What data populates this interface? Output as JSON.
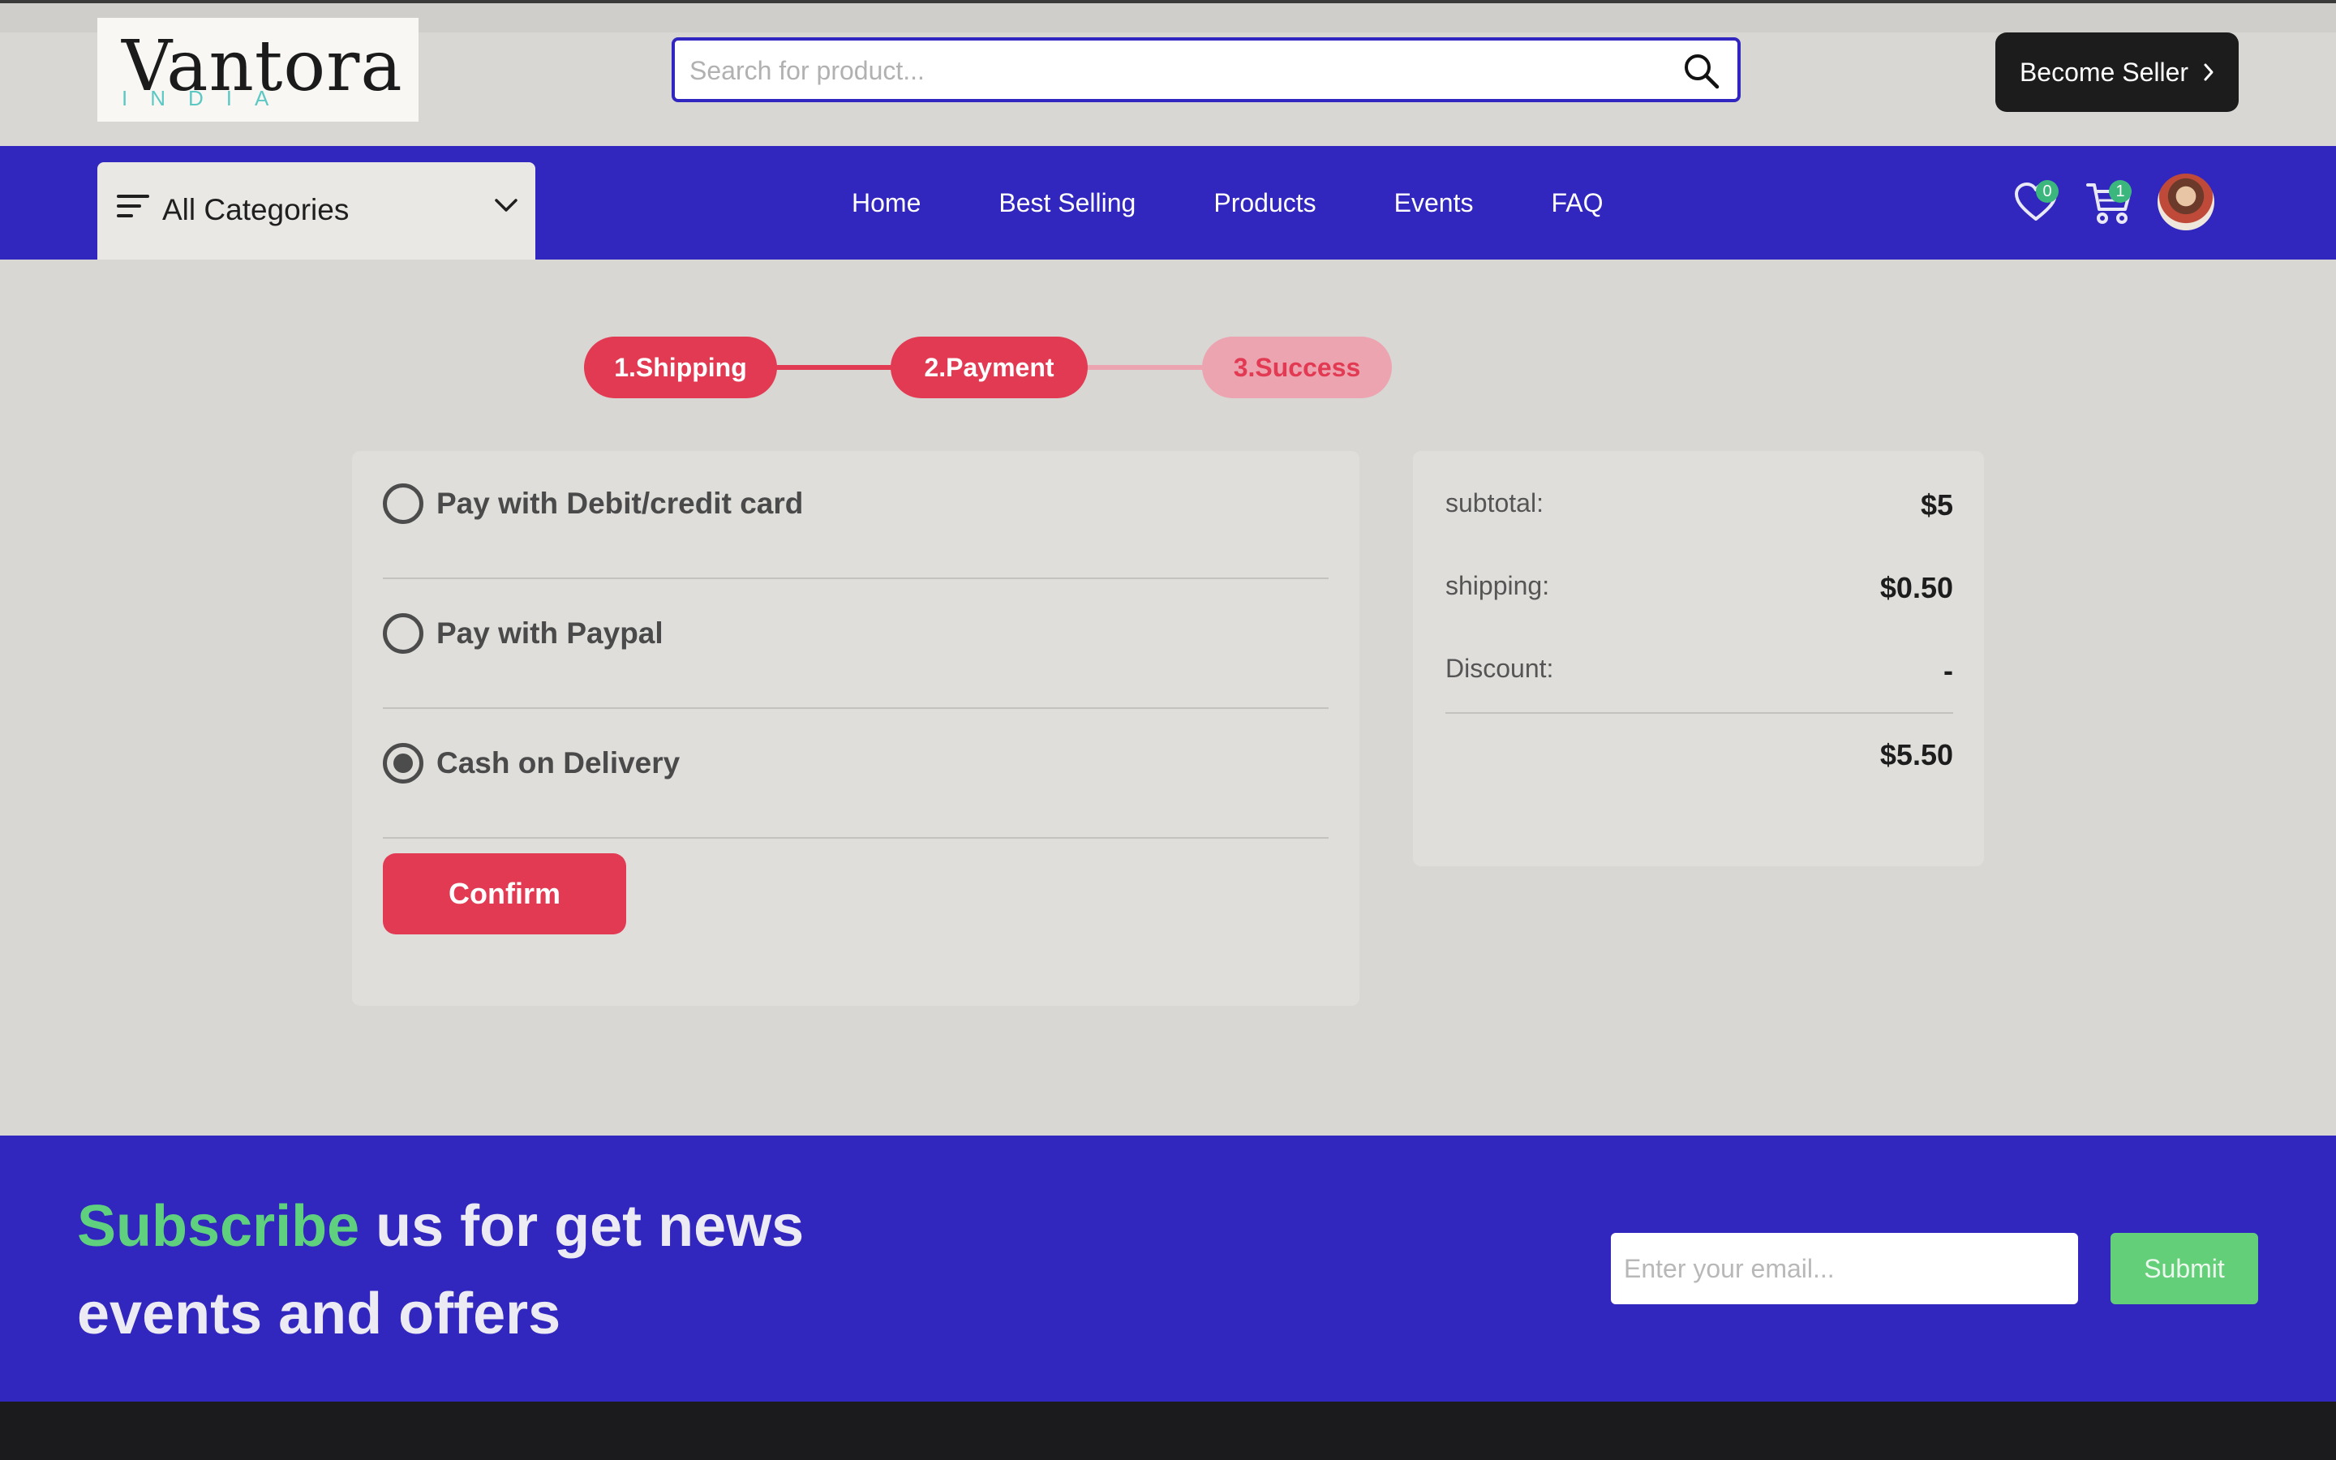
{
  "header": {
    "logo": {
      "name": "Vantora",
      "sub": "INDIA"
    },
    "search": {
      "placeholder": "Search for product..."
    },
    "seller_button": "Become Seller"
  },
  "nav": {
    "categories_label": "All Categories",
    "links": [
      "Home",
      "Best Selling",
      "Products",
      "Events",
      "FAQ"
    ],
    "wishlist_count": "0",
    "cart_count": "1"
  },
  "checkout": {
    "steps": [
      {
        "label": "1.Shipping",
        "state": "done"
      },
      {
        "label": "2.Payment",
        "state": "active"
      },
      {
        "label": "3.Success",
        "state": "pending"
      }
    ],
    "payment_options": [
      {
        "label": "Pay with Debit/credit card",
        "selected": false
      },
      {
        "label": "Pay with Paypal",
        "selected": false
      },
      {
        "label": "Cash on Delivery",
        "selected": true
      }
    ],
    "confirm_label": "Confirm",
    "summary": {
      "subtotal_label": "subtotal:",
      "subtotal_value": "$5",
      "shipping_label": "shipping:",
      "shipping_value": "$0.50",
      "discount_label": "Discount:",
      "discount_value": "-",
      "total_value": "$5.50"
    }
  },
  "newsletter": {
    "title_highlight": "Subscribe",
    "title_rest_line1": " us for get news",
    "title_line2": "events and offers",
    "email_placeholder": "Enter your email...",
    "submit_label": "Submit"
  },
  "colors": {
    "brand_blue": "#3126bd",
    "accent_red": "#e23a52",
    "accent_green": "#5fd07d",
    "page_bg": "#d8d7d3"
  }
}
